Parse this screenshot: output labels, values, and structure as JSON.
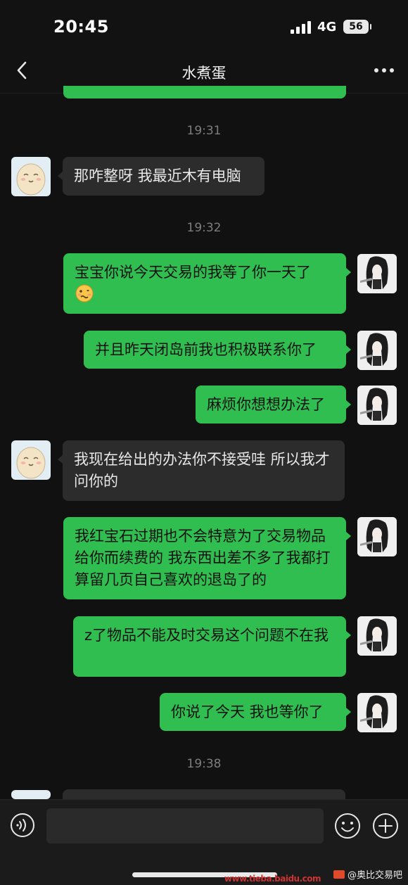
{
  "status_bar": {
    "time": "20:45",
    "network": "4G",
    "battery": "56"
  },
  "nav": {
    "title": "水煮蛋"
  },
  "timestamps": [
    "19:31",
    "19:32",
    "19:38"
  ],
  "messages": [
    {
      "side": "left",
      "text": "那咋整呀 我最近木有电脑"
    },
    {
      "side": "right",
      "text": "宝宝你说今天交易的我等了你一天了",
      "emoji": "woozy-face"
    },
    {
      "side": "right",
      "text": "并且昨天闭岛前我也积极联系你了"
    },
    {
      "side": "right",
      "text": "麻烦你想想办法了"
    },
    {
      "side": "left",
      "text": "我现在给出的办法你不接受哇 所以我才问你的"
    },
    {
      "side": "right",
      "text": "我红宝石过期也不会特意为了交易物品给你而续费的 我东西出差不多了我都打算留几页自己喜欢的退岛了的"
    },
    {
      "side": "right",
      "text": "z了物品不能及时交易这个问题不在我"
    },
    {
      "side": "right",
      "text": "你说了今天 我也等你了"
    }
  ],
  "input": {
    "value": "",
    "placeholder": ""
  },
  "watermark": {
    "label": "@奥比交易吧",
    "url": "www.tieba.baidu.com"
  },
  "colors": {
    "background": "#111111",
    "sent_bubble": "#2fbe4f",
    "received_bubble": "#2c2c2c",
    "timestamp": "#7d7d7d"
  },
  "icons": {
    "back": "chevron-left-icon",
    "more": "more-dots-icon",
    "voice": "voice-icon",
    "emoji": "emoji-icon",
    "plus": "plus-icon"
  }
}
